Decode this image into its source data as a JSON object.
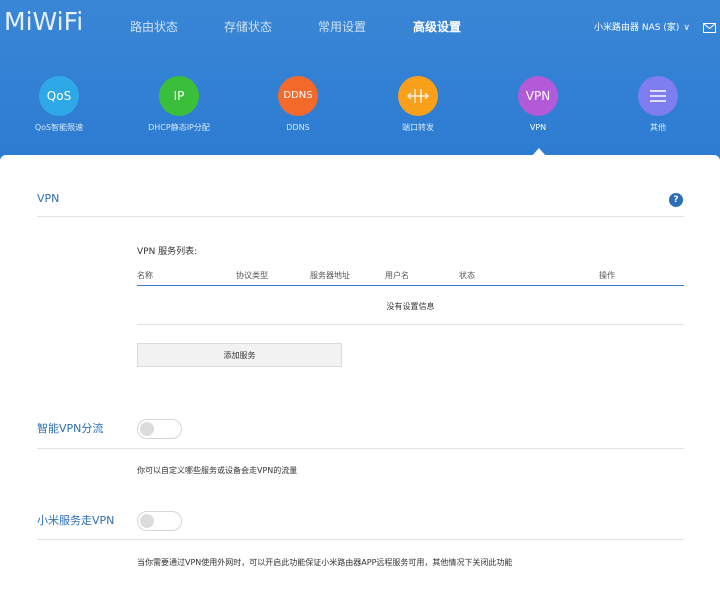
{
  "logo": "MiWiFi",
  "nav": [
    {
      "label": "路由状态"
    },
    {
      "label": "存储状态"
    },
    {
      "label": "常用设置"
    },
    {
      "label": "高级设置"
    }
  ],
  "device": {
    "name": "小米路由器 NAS (家)"
  },
  "features": [
    {
      "icon_text": "QoS",
      "label": "QoS智能限速",
      "color": "#2fa8e8"
    },
    {
      "icon_text": "IP",
      "label": "DHCP静态IP分配",
      "color": "#3bbf3b"
    },
    {
      "icon_text": "DDNS",
      "label": "DDNS",
      "color": "#f36a2a"
    },
    {
      "icon_text": "",
      "label": "端口转发",
      "color": "#f9a01b",
      "icon": "port-forward-icon"
    },
    {
      "icon_text": "VPN",
      "label": "VPN",
      "color": "#b35ad9"
    },
    {
      "icon_text": "",
      "label": "其他",
      "color": "#7f7ef0",
      "icon": "menu-icon"
    }
  ],
  "vpn": {
    "title": "VPN",
    "help": "?",
    "list_title": "VPN 服务列表:",
    "columns": [
      "名称",
      "协议类型",
      "服务器地址",
      "用户名",
      "状态",
      "操作"
    ],
    "empty": "没有设置信息",
    "add_button": "添加服务"
  },
  "smart_vpn": {
    "title": "智能VPN分流",
    "enabled": false,
    "desc": "你可以自定义哪些服务或设备会走VPN的流量"
  },
  "mi_vpn": {
    "title": "小米服务走VPN",
    "enabled": false,
    "desc": "当你需要通过VPN使用外网时，可以开启此功能保证小米路由器APP远程服务可用，其他情况下关闭此功能"
  }
}
